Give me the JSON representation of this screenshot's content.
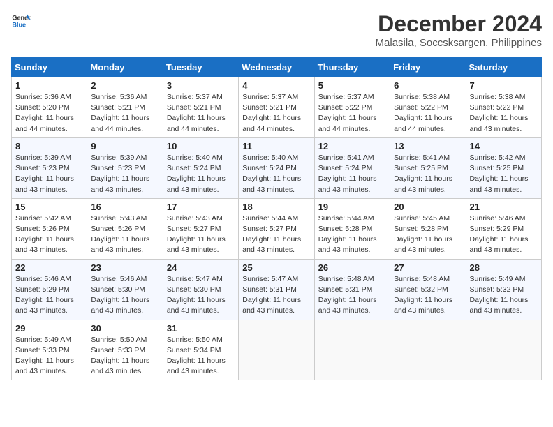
{
  "header": {
    "logo_general": "General",
    "logo_blue": "Blue",
    "title": "December 2024",
    "subtitle": "Malasila, Soccsksargen, Philippines"
  },
  "calendar": {
    "weekdays": [
      "Sunday",
      "Monday",
      "Tuesday",
      "Wednesday",
      "Thursday",
      "Friday",
      "Saturday"
    ],
    "weeks": [
      [
        null,
        {
          "day": 2,
          "sunrise": "5:36 AM",
          "sunset": "5:21 PM",
          "daylight": "11 hours and 44 minutes."
        },
        {
          "day": 3,
          "sunrise": "5:37 AM",
          "sunset": "5:21 PM",
          "daylight": "11 hours and 44 minutes."
        },
        {
          "day": 4,
          "sunrise": "5:37 AM",
          "sunset": "5:21 PM",
          "daylight": "11 hours and 44 minutes."
        },
        {
          "day": 5,
          "sunrise": "5:37 AM",
          "sunset": "5:22 PM",
          "daylight": "11 hours and 44 minutes."
        },
        {
          "day": 6,
          "sunrise": "5:38 AM",
          "sunset": "5:22 PM",
          "daylight": "11 hours and 44 minutes."
        },
        {
          "day": 7,
          "sunrise": "5:38 AM",
          "sunset": "5:22 PM",
          "daylight": "11 hours and 43 minutes."
        }
      ],
      [
        {
          "day": 1,
          "sunrise": "5:36 AM",
          "sunset": "5:20 PM",
          "daylight": "11 hours and 44 minutes.",
          "is_row1_sunday": true
        },
        {
          "day": 9,
          "sunrise": "5:39 AM",
          "sunset": "5:23 PM",
          "daylight": "11 hours and 43 minutes."
        },
        {
          "day": 10,
          "sunrise": "5:40 AM",
          "sunset": "5:24 PM",
          "daylight": "11 hours and 43 minutes."
        },
        {
          "day": 11,
          "sunrise": "5:40 AM",
          "sunset": "5:24 PM",
          "daylight": "11 hours and 43 minutes."
        },
        {
          "day": 12,
          "sunrise": "5:41 AM",
          "sunset": "5:24 PM",
          "daylight": "11 hours and 43 minutes."
        },
        {
          "day": 13,
          "sunrise": "5:41 AM",
          "sunset": "5:25 PM",
          "daylight": "11 hours and 43 minutes."
        },
        {
          "day": 14,
          "sunrise": "5:42 AM",
          "sunset": "5:25 PM",
          "daylight": "11 hours and 43 minutes."
        }
      ],
      [
        {
          "day": 8,
          "sunrise": "5:39 AM",
          "sunset": "5:23 PM",
          "daylight": "11 hours and 43 minutes.",
          "is_row2_sunday": true
        },
        {
          "day": 16,
          "sunrise": "5:43 AM",
          "sunset": "5:26 PM",
          "daylight": "11 hours and 43 minutes."
        },
        {
          "day": 17,
          "sunrise": "5:43 AM",
          "sunset": "5:27 PM",
          "daylight": "11 hours and 43 minutes."
        },
        {
          "day": 18,
          "sunrise": "5:44 AM",
          "sunset": "5:27 PM",
          "daylight": "11 hours and 43 minutes."
        },
        {
          "day": 19,
          "sunrise": "5:44 AM",
          "sunset": "5:28 PM",
          "daylight": "11 hours and 43 minutes."
        },
        {
          "day": 20,
          "sunrise": "5:45 AM",
          "sunset": "5:28 PM",
          "daylight": "11 hours and 43 minutes."
        },
        {
          "day": 21,
          "sunrise": "5:46 AM",
          "sunset": "5:29 PM",
          "daylight": "11 hours and 43 minutes."
        }
      ],
      [
        {
          "day": 15,
          "sunrise": "5:42 AM",
          "sunset": "5:26 PM",
          "daylight": "11 hours and 43 minutes.",
          "is_row3_sunday": true
        },
        {
          "day": 23,
          "sunrise": "5:46 AM",
          "sunset": "5:30 PM",
          "daylight": "11 hours and 43 minutes."
        },
        {
          "day": 24,
          "sunrise": "5:47 AM",
          "sunset": "5:30 PM",
          "daylight": "11 hours and 43 minutes."
        },
        {
          "day": 25,
          "sunrise": "5:47 AM",
          "sunset": "5:31 PM",
          "daylight": "11 hours and 43 minutes."
        },
        {
          "day": 26,
          "sunrise": "5:48 AM",
          "sunset": "5:31 PM",
          "daylight": "11 hours and 43 minutes."
        },
        {
          "day": 27,
          "sunrise": "5:48 AM",
          "sunset": "5:32 PM",
          "daylight": "11 hours and 43 minutes."
        },
        {
          "day": 28,
          "sunrise": "5:49 AM",
          "sunset": "5:32 PM",
          "daylight": "11 hours and 43 minutes."
        }
      ],
      [
        {
          "day": 22,
          "sunrise": "5:46 AM",
          "sunset": "5:29 PM",
          "daylight": "11 hours and 43 minutes.",
          "is_row4_sunday": true
        },
        {
          "day": 30,
          "sunrise": "5:50 AM",
          "sunset": "5:33 PM",
          "daylight": "11 hours and 43 minutes."
        },
        {
          "day": 31,
          "sunrise": "5:50 AM",
          "sunset": "5:34 PM",
          "daylight": "11 hours and 43 minutes."
        },
        null,
        null,
        null,
        null
      ],
      [
        {
          "day": 29,
          "sunrise": "5:49 AM",
          "sunset": "5:33 PM",
          "daylight": "11 hours and 43 minutes.",
          "is_row5_sunday": true
        },
        null,
        null,
        null,
        null,
        null,
        null
      ]
    ]
  },
  "rows_layout": [
    {
      "cells": [
        {
          "day": 1,
          "sunrise": "5:36 AM",
          "sunset": "5:20 PM",
          "daylight": "11 hours and 44 minutes."
        },
        {
          "day": 2,
          "sunrise": "5:36 AM",
          "sunset": "5:21 PM",
          "daylight": "11 hours and 44 minutes."
        },
        {
          "day": 3,
          "sunrise": "5:37 AM",
          "sunset": "5:21 PM",
          "daylight": "11 hours and 44 minutes."
        },
        {
          "day": 4,
          "sunrise": "5:37 AM",
          "sunset": "5:21 PM",
          "daylight": "11 hours and 44 minutes."
        },
        {
          "day": 5,
          "sunrise": "5:37 AM",
          "sunset": "5:22 PM",
          "daylight": "11 hours and 44 minutes."
        },
        {
          "day": 6,
          "sunrise": "5:38 AM",
          "sunset": "5:22 PM",
          "daylight": "11 hours and 44 minutes."
        },
        {
          "day": 7,
          "sunrise": "5:38 AM",
          "sunset": "5:22 PM",
          "daylight": "11 hours and 43 minutes."
        }
      ]
    },
    {
      "cells": [
        {
          "day": 8,
          "sunrise": "5:39 AM",
          "sunset": "5:23 PM",
          "daylight": "11 hours and 43 minutes."
        },
        {
          "day": 9,
          "sunrise": "5:39 AM",
          "sunset": "5:23 PM",
          "daylight": "11 hours and 43 minutes."
        },
        {
          "day": 10,
          "sunrise": "5:40 AM",
          "sunset": "5:24 PM",
          "daylight": "11 hours and 43 minutes."
        },
        {
          "day": 11,
          "sunrise": "5:40 AM",
          "sunset": "5:24 PM",
          "daylight": "11 hours and 43 minutes."
        },
        {
          "day": 12,
          "sunrise": "5:41 AM",
          "sunset": "5:24 PM",
          "daylight": "11 hours and 43 minutes."
        },
        {
          "day": 13,
          "sunrise": "5:41 AM",
          "sunset": "5:25 PM",
          "daylight": "11 hours and 43 minutes."
        },
        {
          "day": 14,
          "sunrise": "5:42 AM",
          "sunset": "5:25 PM",
          "daylight": "11 hours and 43 minutes."
        }
      ]
    },
    {
      "cells": [
        {
          "day": 15,
          "sunrise": "5:42 AM",
          "sunset": "5:26 PM",
          "daylight": "11 hours and 43 minutes."
        },
        {
          "day": 16,
          "sunrise": "5:43 AM",
          "sunset": "5:26 PM",
          "daylight": "11 hours and 43 minutes."
        },
        {
          "day": 17,
          "sunrise": "5:43 AM",
          "sunset": "5:27 PM",
          "daylight": "11 hours and 43 minutes."
        },
        {
          "day": 18,
          "sunrise": "5:44 AM",
          "sunset": "5:27 PM",
          "daylight": "11 hours and 43 minutes."
        },
        {
          "day": 19,
          "sunrise": "5:44 AM",
          "sunset": "5:28 PM",
          "daylight": "11 hours and 43 minutes."
        },
        {
          "day": 20,
          "sunrise": "5:45 AM",
          "sunset": "5:28 PM",
          "daylight": "11 hours and 43 minutes."
        },
        {
          "day": 21,
          "sunrise": "5:46 AM",
          "sunset": "5:29 PM",
          "daylight": "11 hours and 43 minutes."
        }
      ]
    },
    {
      "cells": [
        {
          "day": 22,
          "sunrise": "5:46 AM",
          "sunset": "5:29 PM",
          "daylight": "11 hours and 43 minutes."
        },
        {
          "day": 23,
          "sunrise": "5:46 AM",
          "sunset": "5:30 PM",
          "daylight": "11 hours and 43 minutes."
        },
        {
          "day": 24,
          "sunrise": "5:47 AM",
          "sunset": "5:30 PM",
          "daylight": "11 hours and 43 minutes."
        },
        {
          "day": 25,
          "sunrise": "5:47 AM",
          "sunset": "5:31 PM",
          "daylight": "11 hours and 43 minutes."
        },
        {
          "day": 26,
          "sunrise": "5:48 AM",
          "sunset": "5:31 PM",
          "daylight": "11 hours and 43 minutes."
        },
        {
          "day": 27,
          "sunrise": "5:48 AM",
          "sunset": "5:32 PM",
          "daylight": "11 hours and 43 minutes."
        },
        {
          "day": 28,
          "sunrise": "5:49 AM",
          "sunset": "5:32 PM",
          "daylight": "11 hours and 43 minutes."
        }
      ]
    },
    {
      "cells": [
        {
          "day": 29,
          "sunrise": "5:49 AM",
          "sunset": "5:33 PM",
          "daylight": "11 hours and 43 minutes."
        },
        {
          "day": 30,
          "sunrise": "5:50 AM",
          "sunset": "5:33 PM",
          "daylight": "11 hours and 43 minutes."
        },
        {
          "day": 31,
          "sunrise": "5:50 AM",
          "sunset": "5:34 PM",
          "daylight": "11 hours and 43 minutes."
        },
        null,
        null,
        null,
        null
      ]
    }
  ]
}
